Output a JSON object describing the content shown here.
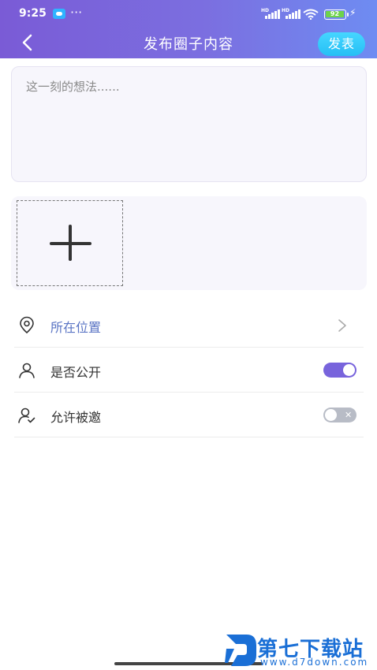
{
  "status_bar": {
    "time": "9:25",
    "more": "···",
    "signal_label": "HD",
    "battery_level": "92",
    "icons": [
      "chat-bubble-icon",
      "signal-icon",
      "wifi-icon",
      "battery-icon",
      "charging-icon"
    ]
  },
  "header": {
    "title": "发布圈子内容",
    "publish_label": "发表",
    "back_icon": "chevron-left-icon",
    "colors": {
      "gradient_start": "#7a5bd6",
      "gradient_end": "#6e8cf2",
      "publish_button": "#2cc6fa"
    }
  },
  "post": {
    "placeholder": "这一刻的想法......",
    "value": ""
  },
  "media": {
    "add_icon": "plus-icon"
  },
  "options": [
    {
      "icon": "location-pin-icon",
      "label": "所在位置",
      "control": "chevron-right-icon"
    },
    {
      "icon": "user-icon",
      "label": "是否公开",
      "control": "toggle",
      "toggle_on": true
    },
    {
      "icon": "user-check-icon",
      "label": "允许被邀",
      "control": "toggle",
      "toggle_on": false
    }
  ],
  "watermark": {
    "title": "第七下载站",
    "url": "www.d7down.com",
    "color": "#1a6fd6"
  }
}
